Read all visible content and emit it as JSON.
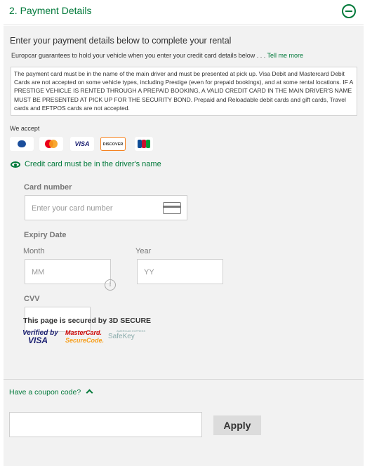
{
  "section": {
    "title": "2. Payment Details"
  },
  "intro": "Enter your payment details below to complete your rental",
  "guarantee": {
    "text": "Europcar guarantees to hold your vehicle when you enter your credit card details below . . .",
    "link": "Tell me more"
  },
  "terms": "The payment card must be in the name of the main driver and must be presented at pick up.  Visa Debit and Mastercard Debit Cards are not accepted on some vehicle types, including Prestige (even for prepaid bookings), and at some rental locations. IF A PRESTIGE VEHICLE IS RENTED THROUGH A PREPAID BOOKING, A VALID CREDIT CARD IN THE MAIN DRIVER'S NAME MUST BE PRESENTED AT PICK UP FOR THE SECURITY BOND. Prepaid and Reloadable debit cards and gift cards, Travel cards and EFTPOS cards are not accepted.",
  "accept": {
    "label": "We accept",
    "cards": {
      "visa": "VISA",
      "discover": "DISCOVER"
    }
  },
  "driver_note": "Credit card must be in the driver's name",
  "card_number": {
    "label": "Card number",
    "placeholder": "Enter your card number"
  },
  "expiry": {
    "label": "Expiry Date",
    "month_label": "Month",
    "month_placeholder": "MM",
    "year_label": "Year",
    "year_placeholder": "YY"
  },
  "cvv": {
    "label": "CVV",
    "info": "i"
  },
  "secure": {
    "text": "This page is secured by 3D SECURE",
    "vbv_line1": "Verified by",
    "vbv_line2": "VISA",
    "mc_line1": "MasterCard.",
    "mc_line2": "SecureCode.",
    "amex_line1": "AMERICAN EXPRESS",
    "amex_line2": "SafeKey"
  },
  "coupon": {
    "toggle": "Have a coupon code?",
    "input_value": "",
    "apply": "Apply"
  },
  "colors": {
    "brand_green": "#00793a",
    "panel_bg": "#f2f2f2"
  }
}
